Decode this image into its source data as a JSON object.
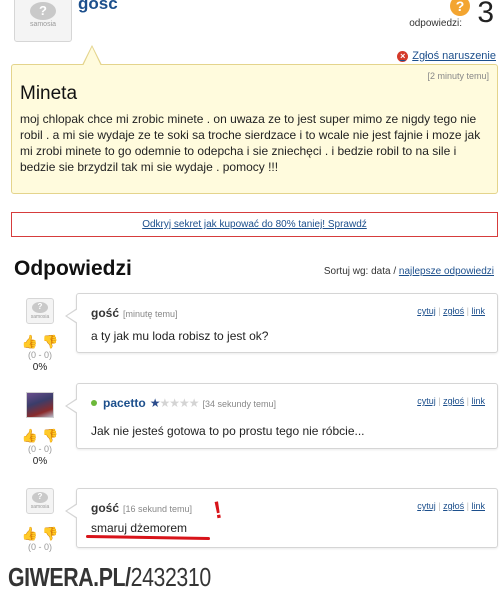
{
  "header": {
    "username": "gosc",
    "avatar_tag": "samosia",
    "answers_label": "odpowiedzi:",
    "answers_count": "3",
    "badge_icon": "?",
    "report_label": "Zgłoś naruszenie"
  },
  "question": {
    "time": "[2 minuty temu]",
    "title": "Mineta",
    "body": "moj chlopak chce mi zrobic minete . on uwaza ze to jest super mimo ze nigdy tego nie robil . a mi sie wydaje ze te soki sa troche sierdzace i to wcale nie jest fajnie i moze jak mi zrobi minete to go odemnie to odepcha i sie zniechęci . i bedzie robil to na sile i bedzie sie brzydzil tak mi sie wydaje . pomocy !!!"
  },
  "promo": {
    "text": "Odkryj sekret jak kupować do 80% taniej! Sprawdź"
  },
  "answers_section": {
    "heading": "Odpowiedzi",
    "sort_label": "Sortuj wg: data /",
    "sort_link": "najlepsze odpowiedzi"
  },
  "actions": {
    "quote": "cytuj",
    "report": "zgłoś",
    "link": "link",
    "separator": "|"
  },
  "answers": [
    {
      "user": "gość",
      "time": "[minutę temu]",
      "text": "a ty jak mu loda robisz to jest ok?",
      "tally": "(0 - 0)",
      "percent": "0%"
    },
    {
      "user": "pacetto",
      "time": "[34 sekundy temu]",
      "text": "Jak nie jesteś gotowa to po prostu tego nie róbcie...",
      "tally": "(0 - 0)",
      "percent": "0%",
      "rating_stars": 1,
      "rating_max": 5
    },
    {
      "user": "gość",
      "time": "[16 sekund temu]",
      "text": "smaruj dżemorem",
      "tally": "(0 - 0)"
    }
  ],
  "annotation": {
    "mark": "!"
  },
  "watermark": {
    "site": "GIWERA.PL/",
    "code": "2432310"
  },
  "colors": {
    "link": "#1c4f8c",
    "question_bg": "#fffbdd",
    "accent_red": "#d8141a",
    "badge_orange": "#f3a531"
  }
}
